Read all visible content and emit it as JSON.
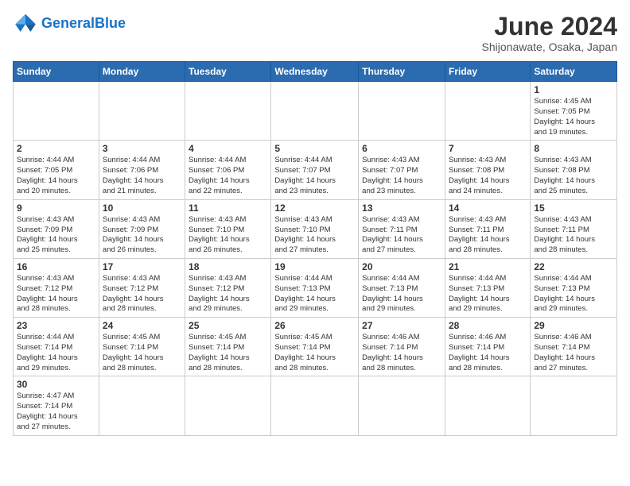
{
  "header": {
    "logo_text_normal": "General",
    "logo_text_blue": "Blue",
    "month_title": "June 2024",
    "location": "Shijonawate, Osaka, Japan"
  },
  "weekdays": [
    "Sunday",
    "Monday",
    "Tuesday",
    "Wednesday",
    "Thursday",
    "Friday",
    "Saturday"
  ],
  "weeks": [
    [
      {
        "day": "",
        "info": ""
      },
      {
        "day": "",
        "info": ""
      },
      {
        "day": "",
        "info": ""
      },
      {
        "day": "",
        "info": ""
      },
      {
        "day": "",
        "info": ""
      },
      {
        "day": "",
        "info": ""
      },
      {
        "day": "1",
        "info": "Sunrise: 4:45 AM\nSunset: 7:05 PM\nDaylight: 14 hours\nand 19 minutes."
      }
    ],
    [
      {
        "day": "2",
        "info": "Sunrise: 4:44 AM\nSunset: 7:05 PM\nDaylight: 14 hours\nand 20 minutes."
      },
      {
        "day": "3",
        "info": "Sunrise: 4:44 AM\nSunset: 7:06 PM\nDaylight: 14 hours\nand 21 minutes."
      },
      {
        "day": "4",
        "info": "Sunrise: 4:44 AM\nSunset: 7:06 PM\nDaylight: 14 hours\nand 22 minutes."
      },
      {
        "day": "5",
        "info": "Sunrise: 4:44 AM\nSunset: 7:07 PM\nDaylight: 14 hours\nand 23 minutes."
      },
      {
        "day": "6",
        "info": "Sunrise: 4:43 AM\nSunset: 7:07 PM\nDaylight: 14 hours\nand 23 minutes."
      },
      {
        "day": "7",
        "info": "Sunrise: 4:43 AM\nSunset: 7:08 PM\nDaylight: 14 hours\nand 24 minutes."
      },
      {
        "day": "8",
        "info": "Sunrise: 4:43 AM\nSunset: 7:08 PM\nDaylight: 14 hours\nand 25 minutes."
      }
    ],
    [
      {
        "day": "9",
        "info": "Sunrise: 4:43 AM\nSunset: 7:09 PM\nDaylight: 14 hours\nand 25 minutes."
      },
      {
        "day": "10",
        "info": "Sunrise: 4:43 AM\nSunset: 7:09 PM\nDaylight: 14 hours\nand 26 minutes."
      },
      {
        "day": "11",
        "info": "Sunrise: 4:43 AM\nSunset: 7:10 PM\nDaylight: 14 hours\nand 26 minutes."
      },
      {
        "day": "12",
        "info": "Sunrise: 4:43 AM\nSunset: 7:10 PM\nDaylight: 14 hours\nand 27 minutes."
      },
      {
        "day": "13",
        "info": "Sunrise: 4:43 AM\nSunset: 7:11 PM\nDaylight: 14 hours\nand 27 minutes."
      },
      {
        "day": "14",
        "info": "Sunrise: 4:43 AM\nSunset: 7:11 PM\nDaylight: 14 hours\nand 28 minutes."
      },
      {
        "day": "15",
        "info": "Sunrise: 4:43 AM\nSunset: 7:11 PM\nDaylight: 14 hours\nand 28 minutes."
      }
    ],
    [
      {
        "day": "16",
        "info": "Sunrise: 4:43 AM\nSunset: 7:12 PM\nDaylight: 14 hours\nand 28 minutes."
      },
      {
        "day": "17",
        "info": "Sunrise: 4:43 AM\nSunset: 7:12 PM\nDaylight: 14 hours\nand 28 minutes."
      },
      {
        "day": "18",
        "info": "Sunrise: 4:43 AM\nSunset: 7:12 PM\nDaylight: 14 hours\nand 29 minutes."
      },
      {
        "day": "19",
        "info": "Sunrise: 4:44 AM\nSunset: 7:13 PM\nDaylight: 14 hours\nand 29 minutes."
      },
      {
        "day": "20",
        "info": "Sunrise: 4:44 AM\nSunset: 7:13 PM\nDaylight: 14 hours\nand 29 minutes."
      },
      {
        "day": "21",
        "info": "Sunrise: 4:44 AM\nSunset: 7:13 PM\nDaylight: 14 hours\nand 29 minutes."
      },
      {
        "day": "22",
        "info": "Sunrise: 4:44 AM\nSunset: 7:13 PM\nDaylight: 14 hours\nand 29 minutes."
      }
    ],
    [
      {
        "day": "23",
        "info": "Sunrise: 4:44 AM\nSunset: 7:14 PM\nDaylight: 14 hours\nand 29 minutes."
      },
      {
        "day": "24",
        "info": "Sunrise: 4:45 AM\nSunset: 7:14 PM\nDaylight: 14 hours\nand 28 minutes."
      },
      {
        "day": "25",
        "info": "Sunrise: 4:45 AM\nSunset: 7:14 PM\nDaylight: 14 hours\nand 28 minutes."
      },
      {
        "day": "26",
        "info": "Sunrise: 4:45 AM\nSunset: 7:14 PM\nDaylight: 14 hours\nand 28 minutes."
      },
      {
        "day": "27",
        "info": "Sunrise: 4:46 AM\nSunset: 7:14 PM\nDaylight: 14 hours\nand 28 minutes."
      },
      {
        "day": "28",
        "info": "Sunrise: 4:46 AM\nSunset: 7:14 PM\nDaylight: 14 hours\nand 28 minutes."
      },
      {
        "day": "29",
        "info": "Sunrise: 4:46 AM\nSunset: 7:14 PM\nDaylight: 14 hours\nand 27 minutes."
      }
    ],
    [
      {
        "day": "30",
        "info": "Sunrise: 4:47 AM\nSunset: 7:14 PM\nDaylight: 14 hours\nand 27 minutes."
      },
      {
        "day": "",
        "info": ""
      },
      {
        "day": "",
        "info": ""
      },
      {
        "day": "",
        "info": ""
      },
      {
        "day": "",
        "info": ""
      },
      {
        "day": "",
        "info": ""
      },
      {
        "day": "",
        "info": ""
      }
    ]
  ]
}
